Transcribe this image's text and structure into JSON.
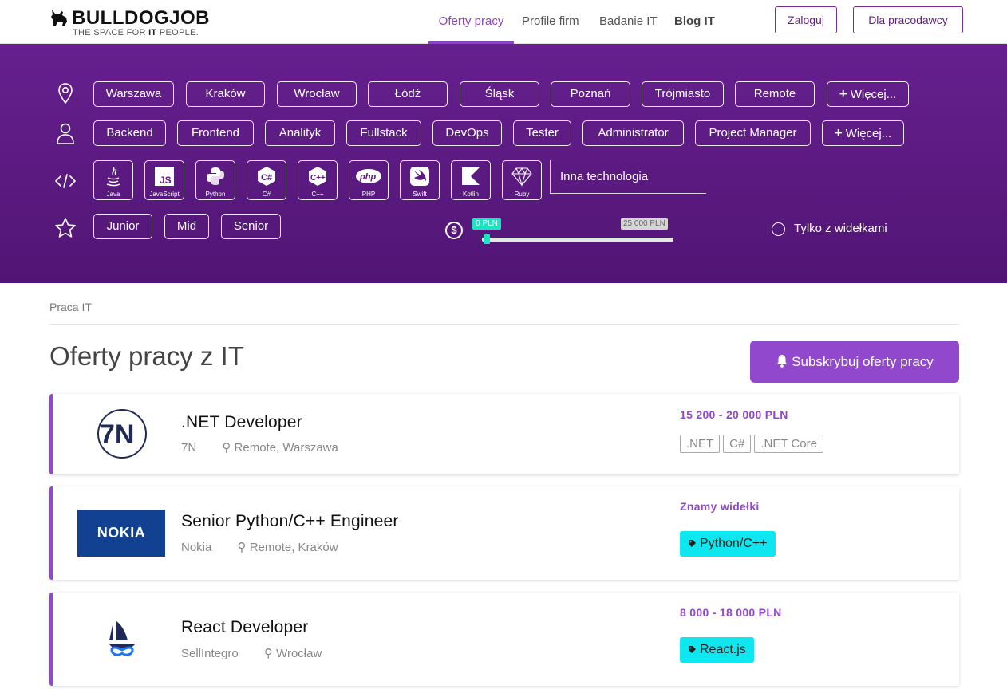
{
  "header": {
    "logo_text": "BULLDOGJOB",
    "logo_tagline_pre": "THE SPACE FOR ",
    "logo_tagline_bold": "IT",
    "logo_tagline_post": " PEOPLE.",
    "nav": [
      "Oferty pracy",
      "Profile firm",
      "Badanie IT",
      "Blog IT"
    ],
    "active_nav": "Oferty pracy",
    "login_label": "Zaloguj",
    "employer_label": "Dla pracodawcy"
  },
  "filters": {
    "cities": [
      "Warszawa",
      "Kraków",
      "Wrocław",
      "Łódź",
      "Śląsk",
      "Poznań",
      "Trójmiasto",
      "Remote"
    ],
    "cities_more": "Więcej...",
    "roles": [
      "Backend",
      "Frontend",
      "Analityk",
      "Fullstack",
      "DevOps",
      "Tester",
      "Administrator",
      "Project Manager"
    ],
    "roles_more": "Więcej...",
    "technologies": [
      "Java",
      "JavaScript",
      "Python",
      "C#",
      "C++",
      "PHP",
      "Swift",
      "Kotlin",
      "Ruby"
    ],
    "other_tech_placeholder": "Inna technologia",
    "levels": [
      "Junior",
      "Mid",
      "Senior"
    ],
    "salary_min_label": "0 PLN",
    "salary_max_label": "25 000 PLN",
    "salary_currency_symbol": "$",
    "salary_only_label": "Tylko z widełkami",
    "salary_only_checked": false
  },
  "breadcrumb": "Praca IT",
  "page_title": "Oferty pracy z IT",
  "subscribe_label": "Subskrybuj oferty pracy",
  "jobs": [
    {
      "title": ".NET Developer",
      "company": "7N",
      "location": "Remote, Warszawa",
      "salary": "15 200 - 20 000 PLN",
      "tags": [
        ".NET",
        "C#",
        ".NET Core"
      ]
    },
    {
      "title": "Senior Python/C++ Engineer",
      "company": "Nokia",
      "logo_text": "NOKIA",
      "location": "Remote, Kraków",
      "salary": "Znamy widełki",
      "highlight_tag": "Python/C++"
    },
    {
      "title": "React Developer",
      "company": "SellIntegro",
      "location": "Wrocław",
      "salary": "8 000 - 18 000 PLN",
      "highlight_tag": "React.js"
    }
  ],
  "colors": {
    "accent": "#9248cd",
    "panel_top": "#66208f",
    "panel_bottom": "#511574",
    "tag_cyan": "#0ee6f0",
    "slider_accent": "#19e5c0",
    "nokia_blue": "#124191"
  }
}
